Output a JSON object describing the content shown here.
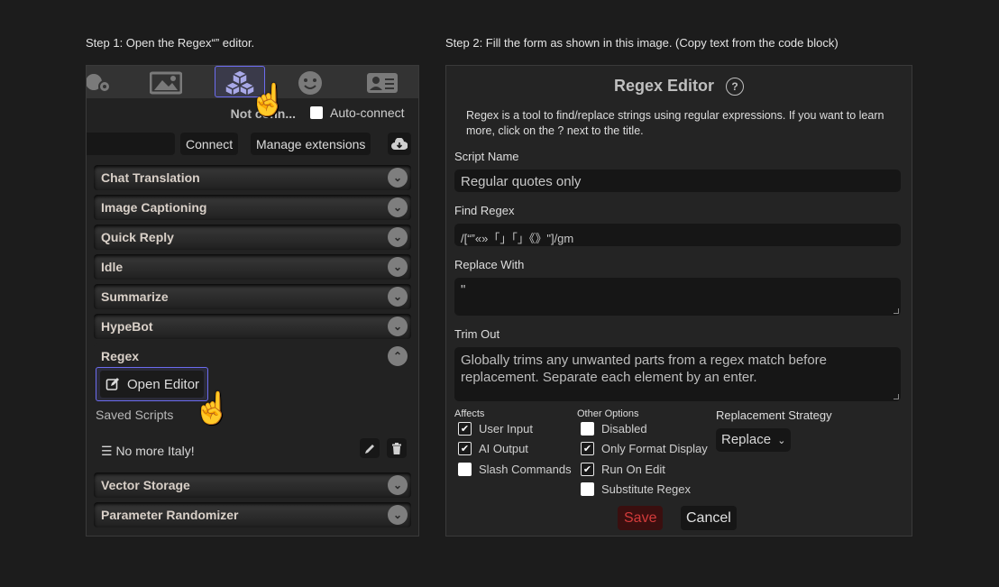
{
  "steps": {
    "step1": "Step 1: Open the Regex“” editor.",
    "step2": "Step 2: Fill the form as shown in this image. (Copy text from the code block)"
  },
  "toolbar": {
    "icons": [
      "extensions-settings-icon",
      "image-icon",
      "extensions-cubes-icon",
      "smiley-icon",
      "persona-card-icon"
    ],
    "active_icon": "extensions-cubes-icon",
    "accent": "#6c6cf0"
  },
  "connection": {
    "status": "Not conn...",
    "status_full": "Not connected...",
    "auto_connect_label": "Auto-connect",
    "auto_connect_checked": false,
    "connect_label": "Connect",
    "manage_label": "Manage extensions"
  },
  "drawers": [
    {
      "label": "Chat Translation",
      "expanded": false
    },
    {
      "label": "Image Captioning",
      "expanded": false
    },
    {
      "label": "Quick Reply",
      "expanded": false
    },
    {
      "label": "Idle",
      "expanded": false
    },
    {
      "label": "Summarize",
      "expanded": false
    },
    {
      "label": "HypeBot",
      "expanded": false
    },
    {
      "label": "Regex",
      "expanded": true
    },
    {
      "label": "Vector Storage",
      "expanded": false
    },
    {
      "label": "Parameter Randomizer",
      "expanded": false
    }
  ],
  "regex_drawer": {
    "open_editor_label": "Open Editor",
    "saved_scripts_label": "Saved Scripts",
    "scripts": [
      {
        "name": "☰ No more Italy!"
      }
    ]
  },
  "editor": {
    "title": "Regex Editor",
    "help_glyph": "?",
    "description": "Regex is a tool to find/replace strings using regular expressions. If you want to learn more, click on the ? next to the title.",
    "script_name_label": "Script Name",
    "script_name_value": "Regular quotes only",
    "find_regex_label": "Find Regex",
    "find_regex_value": "/[“”«»「」「」《》\"]/gm",
    "replace_with_label": "Replace With",
    "replace_with_value": "\"",
    "trim_out_label": "Trim Out",
    "trim_out_placeholder": "Globally trims any unwanted parts from a regex match before replacement. Separate each element by an enter.",
    "affects_label": "Affects",
    "affects": [
      {
        "label": "User Input",
        "checked": true
      },
      {
        "label": "AI Output",
        "checked": true
      },
      {
        "label": "Slash Commands",
        "checked": false
      }
    ],
    "other_options_label": "Other Options",
    "other_options": [
      {
        "label": "Disabled",
        "checked": false
      },
      {
        "label": "Only Format Display",
        "checked": true
      },
      {
        "label": "Run On Edit",
        "checked": true
      },
      {
        "label": "Substitute Regex",
        "checked": false
      }
    ],
    "strategy_label": "Replacement Strategy",
    "strategy_value": "Replace",
    "save_label": "Save",
    "cancel_label": "Cancel",
    "save_color": "#d33b3b"
  }
}
